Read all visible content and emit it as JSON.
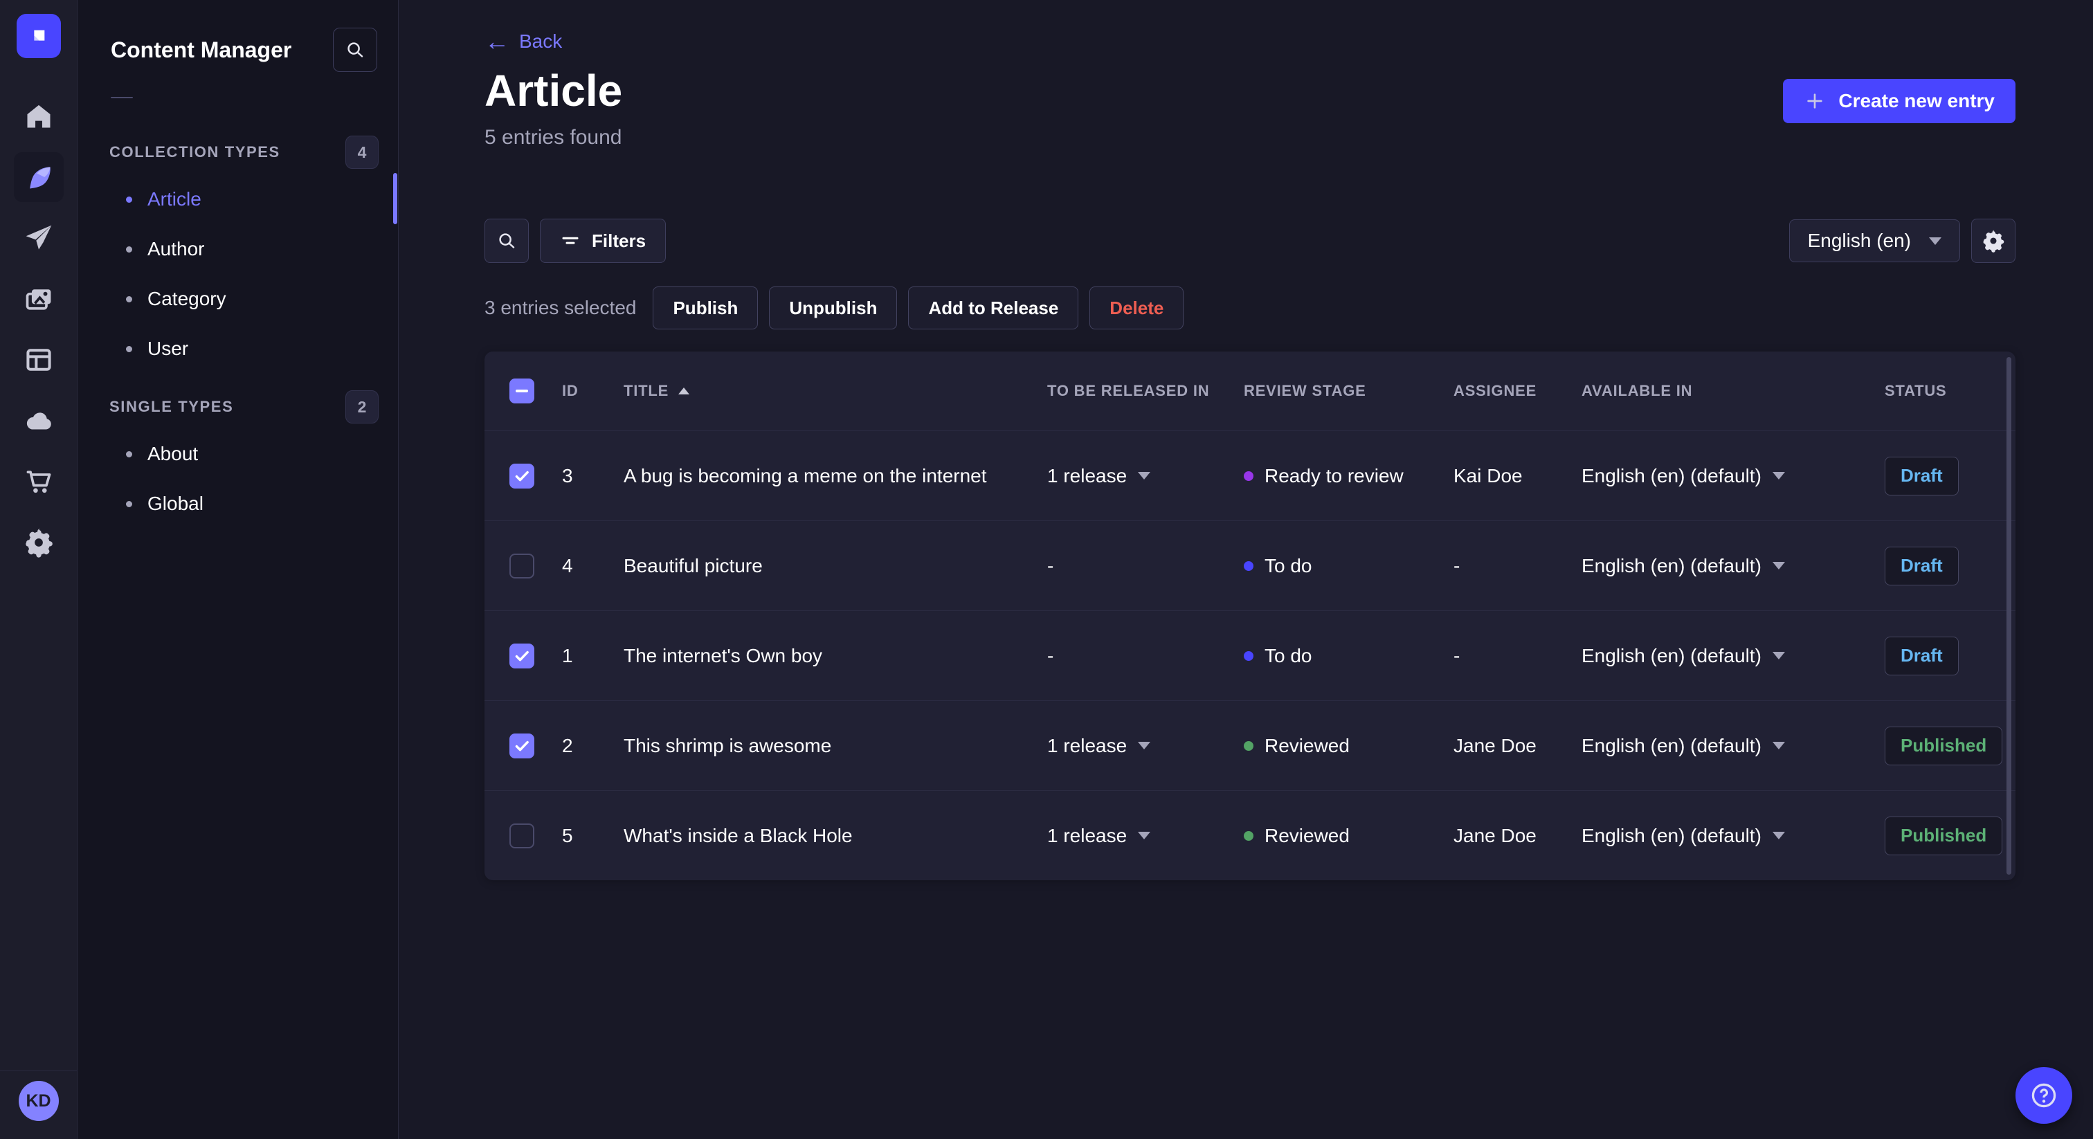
{
  "colors": {
    "primary": "#4945ff",
    "primary_light": "#7b79ff",
    "draft": "#66b7f1",
    "published": "#5cb176",
    "danger": "#ee5e52",
    "stage_todo": "#4945ff",
    "stage_ready_to_review": "#9736e8",
    "stage_reviewed": "#53a365"
  },
  "rail": {
    "logo_icon": "strapi-logo",
    "avatar_initials": "KD",
    "items": [
      {
        "icon": "home-icon",
        "active": false
      },
      {
        "icon": "content-manager-icon",
        "active": true
      },
      {
        "icon": "releases-icon",
        "active": false
      },
      {
        "icon": "media-library-icon",
        "active": false
      },
      {
        "icon": "content-type-builder-icon",
        "active": false
      },
      {
        "icon": "cloud-icon",
        "active": false
      },
      {
        "icon": "marketplace-icon",
        "active": false
      },
      {
        "icon": "settings-icon",
        "active": false
      }
    ]
  },
  "sidebar": {
    "title": "Content Manager",
    "sections": [
      {
        "label": "COLLECTION TYPES",
        "badge": "4",
        "items": [
          {
            "label": "Article",
            "active": true
          },
          {
            "label": "Author",
            "active": false
          },
          {
            "label": "Category",
            "active": false
          },
          {
            "label": "User",
            "active": false
          }
        ]
      },
      {
        "label": "SINGLE TYPES",
        "badge": "2",
        "items": [
          {
            "label": "About",
            "active": false
          },
          {
            "label": "Global",
            "active": false
          }
        ]
      }
    ]
  },
  "page": {
    "back_label": "Back",
    "title": "Article",
    "subtitle": "5 entries found",
    "create_button": "Create new entry"
  },
  "toolbar": {
    "filters_label": "Filters",
    "locale_selected": "English (en)"
  },
  "selection": {
    "summary": "3 entries selected",
    "actions": [
      {
        "label": "Publish",
        "danger": false
      },
      {
        "label": "Unpublish",
        "danger": false
      },
      {
        "label": "Add to Release",
        "danger": false
      },
      {
        "label": "Delete",
        "danger": true
      }
    ]
  },
  "table": {
    "select_all_state": "indeterminate",
    "sort": {
      "column": "TITLE",
      "direction": "asc"
    },
    "headers": [
      {
        "label": "ID"
      },
      {
        "label": "TITLE",
        "sorted": "asc"
      },
      {
        "label": "TO BE RELEASED IN"
      },
      {
        "label": "REVIEW STAGE"
      },
      {
        "label": "ASSIGNEE"
      },
      {
        "label": "AVAILABLE IN"
      },
      {
        "label": "STATUS"
      }
    ],
    "rows": [
      {
        "selected": true,
        "id": "3",
        "title": "A bug is becoming a meme on the internet",
        "to_be_released_in": "1 release",
        "release_menu": true,
        "review_stage": "Ready to review",
        "stage_color": "#9736e8",
        "assignee": "Kai Doe",
        "available_in": "English (en) (default)",
        "status": "Draft"
      },
      {
        "selected": false,
        "id": "4",
        "title": "Beautiful picture",
        "to_be_released_in": "-",
        "release_menu": false,
        "review_stage": "To do",
        "stage_color": "#4945ff",
        "assignee": "-",
        "available_in": "English (en) (default)",
        "status": "Draft"
      },
      {
        "selected": true,
        "id": "1",
        "title": "The internet's Own boy",
        "to_be_released_in": "-",
        "release_menu": false,
        "review_stage": "To do",
        "stage_color": "#4945ff",
        "assignee": "-",
        "available_in": "English (en) (default)",
        "status": "Draft"
      },
      {
        "selected": true,
        "id": "2",
        "title": "This shrimp is awesome",
        "to_be_released_in": "1 release",
        "release_menu": true,
        "review_stage": "Reviewed",
        "stage_color": "#53a365",
        "assignee": "Jane Doe",
        "available_in": "English (en) (default)",
        "status": "Published"
      },
      {
        "selected": false,
        "id": "5",
        "title": "What's inside a Black Hole",
        "to_be_released_in": "1 release",
        "release_menu": true,
        "review_stage": "Reviewed",
        "stage_color": "#53a365",
        "assignee": "Jane Doe",
        "available_in": "English (en) (default)",
        "status": "Published"
      }
    ]
  },
  "help": {
    "icon": "question-mark-icon"
  }
}
